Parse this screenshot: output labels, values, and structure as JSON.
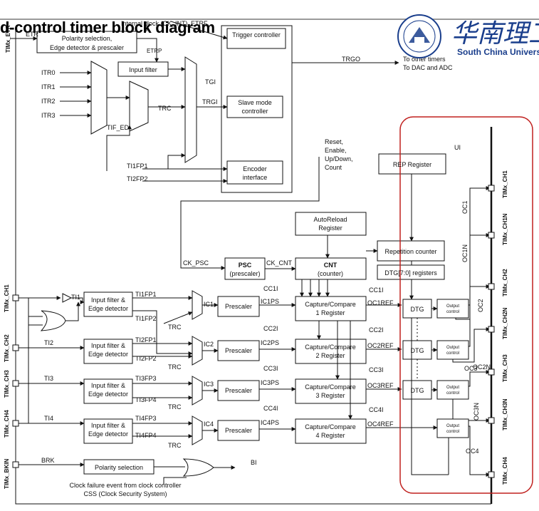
{
  "slide": {
    "title": "d-control timer block diagram",
    "logo_text_cn": "华南理工",
    "logo_text_en": "South China University"
  },
  "colors": {
    "highlight": "#c0201e",
    "logo": "#1a3e8c"
  },
  "top": {
    "internal_clock": "Internal clock (CK_INT)",
    "etr_side": "TIMx_ETR",
    "etr": "ETR",
    "etrf": "ETRF",
    "etrp": "ETRP",
    "polarity": "Polarity selection,",
    "edge_prescaler": "Edge detector & prescaler",
    "trigger_controller": "Trigger controller",
    "input_filter": "Input filter",
    "itr": [
      "ITR0",
      "ITR1",
      "ITR2",
      "ITR3"
    ],
    "tif_ed": "TIF_ED",
    "trc": "TRC",
    "tgi": "TGI",
    "trgi": "TRGI",
    "trgo": "TRGO",
    "other_timers": "To other timers",
    "dac_adc": "To DAC and ADC",
    "slave_mode": [
      "Slave mode",
      "controller"
    ],
    "reset_enable": [
      "Reset,",
      "Enable,",
      "Up/Down,",
      "Count"
    ],
    "ti1fp1": "TI1FP1",
    "ti2fp2": "TI2FP2",
    "encoder": [
      "Encoder",
      "interface"
    ]
  },
  "counter": {
    "ui": "UI",
    "rep_register": "REP Register",
    "autoreload": [
      "AutoReload",
      "Register"
    ],
    "repetition_counter": "Repetition counter",
    "ck_psc": "CK_PSC",
    "psc": "PSC",
    "psc_sub": "(prescaler)",
    "ck_cnt": "CK_CNT",
    "cnt": "CNT",
    "cnt_sub": "(counter)",
    "dtg_registers": "DTG[7:0] registers"
  },
  "channels": [
    {
      "pin": "TIMx_CH1",
      "ti": "TI1",
      "fp_a": "TI1FP1",
      "fp_b": "TI1FP2",
      "ic": "IC1",
      "ccI": "CC1I",
      "icps": "IC1PS",
      "reg": [
        "Capture/Compare",
        "1 Register"
      ],
      "ccI2": "CC1I",
      "ocref": "OC1REF"
    },
    {
      "pin": "TIMx_CH2",
      "ti": "TI2",
      "fp_a": "TI2FP1",
      "fp_b": "TI2FP2",
      "ic": "IC2",
      "ccI": "CC2I",
      "icps": "IC2PS",
      "reg": [
        "Capture/Compare",
        "2 Register"
      ],
      "ccI2": "CC2I",
      "ocref": "OC2REF"
    },
    {
      "pin": "TIMx_CH3",
      "ti": "TI3",
      "fp_a": "TI3FP3",
      "fp_b": "TI3FP4",
      "ic": "IC3",
      "ccI": "CC3I",
      "icps": "IC3PS",
      "reg": [
        "Capture/Compare",
        "3 Register"
      ],
      "ccI2": "CC3I",
      "ocref": "OC3REF"
    },
    {
      "pin": "TIMx_CH4",
      "ti": "TI4",
      "fp_a": "TI4FP3",
      "fp_b": "TI4FP4",
      "ic": "IC4",
      "ccI": "CC4I",
      "icps": "IC4PS",
      "reg": [
        "Capture/Compare",
        "4 Register"
      ],
      "ccI2": "CC4I",
      "ocref": "OC4REF"
    }
  ],
  "common": {
    "filter": [
      "Input filter &",
      "Edge detector"
    ],
    "prescaler": "Prescaler",
    "trc": "TRC",
    "dtg": "DTG",
    "output_control": [
      "Output",
      "control"
    ]
  },
  "outputs": {
    "pins": [
      "TIMx_CH1",
      "TIMx_CH1N",
      "TIMx_CH2",
      "TIMx_CH2N",
      "TIMx_CH3",
      "TIMx_CH3N",
      "TIMx_CH4"
    ],
    "labels": [
      "OC1",
      "OC1N",
      "OC2",
      "OC2N",
      "OC3",
      "OC3N",
      "OC4"
    ]
  },
  "brk": {
    "pin": "TIMx_BKIN",
    "brk": "BRK",
    "polarity": "Polarity selection",
    "bi": "BI",
    "note": [
      "Clock failure event from clock controller",
      "CSS (Clock Security System)"
    ]
  }
}
